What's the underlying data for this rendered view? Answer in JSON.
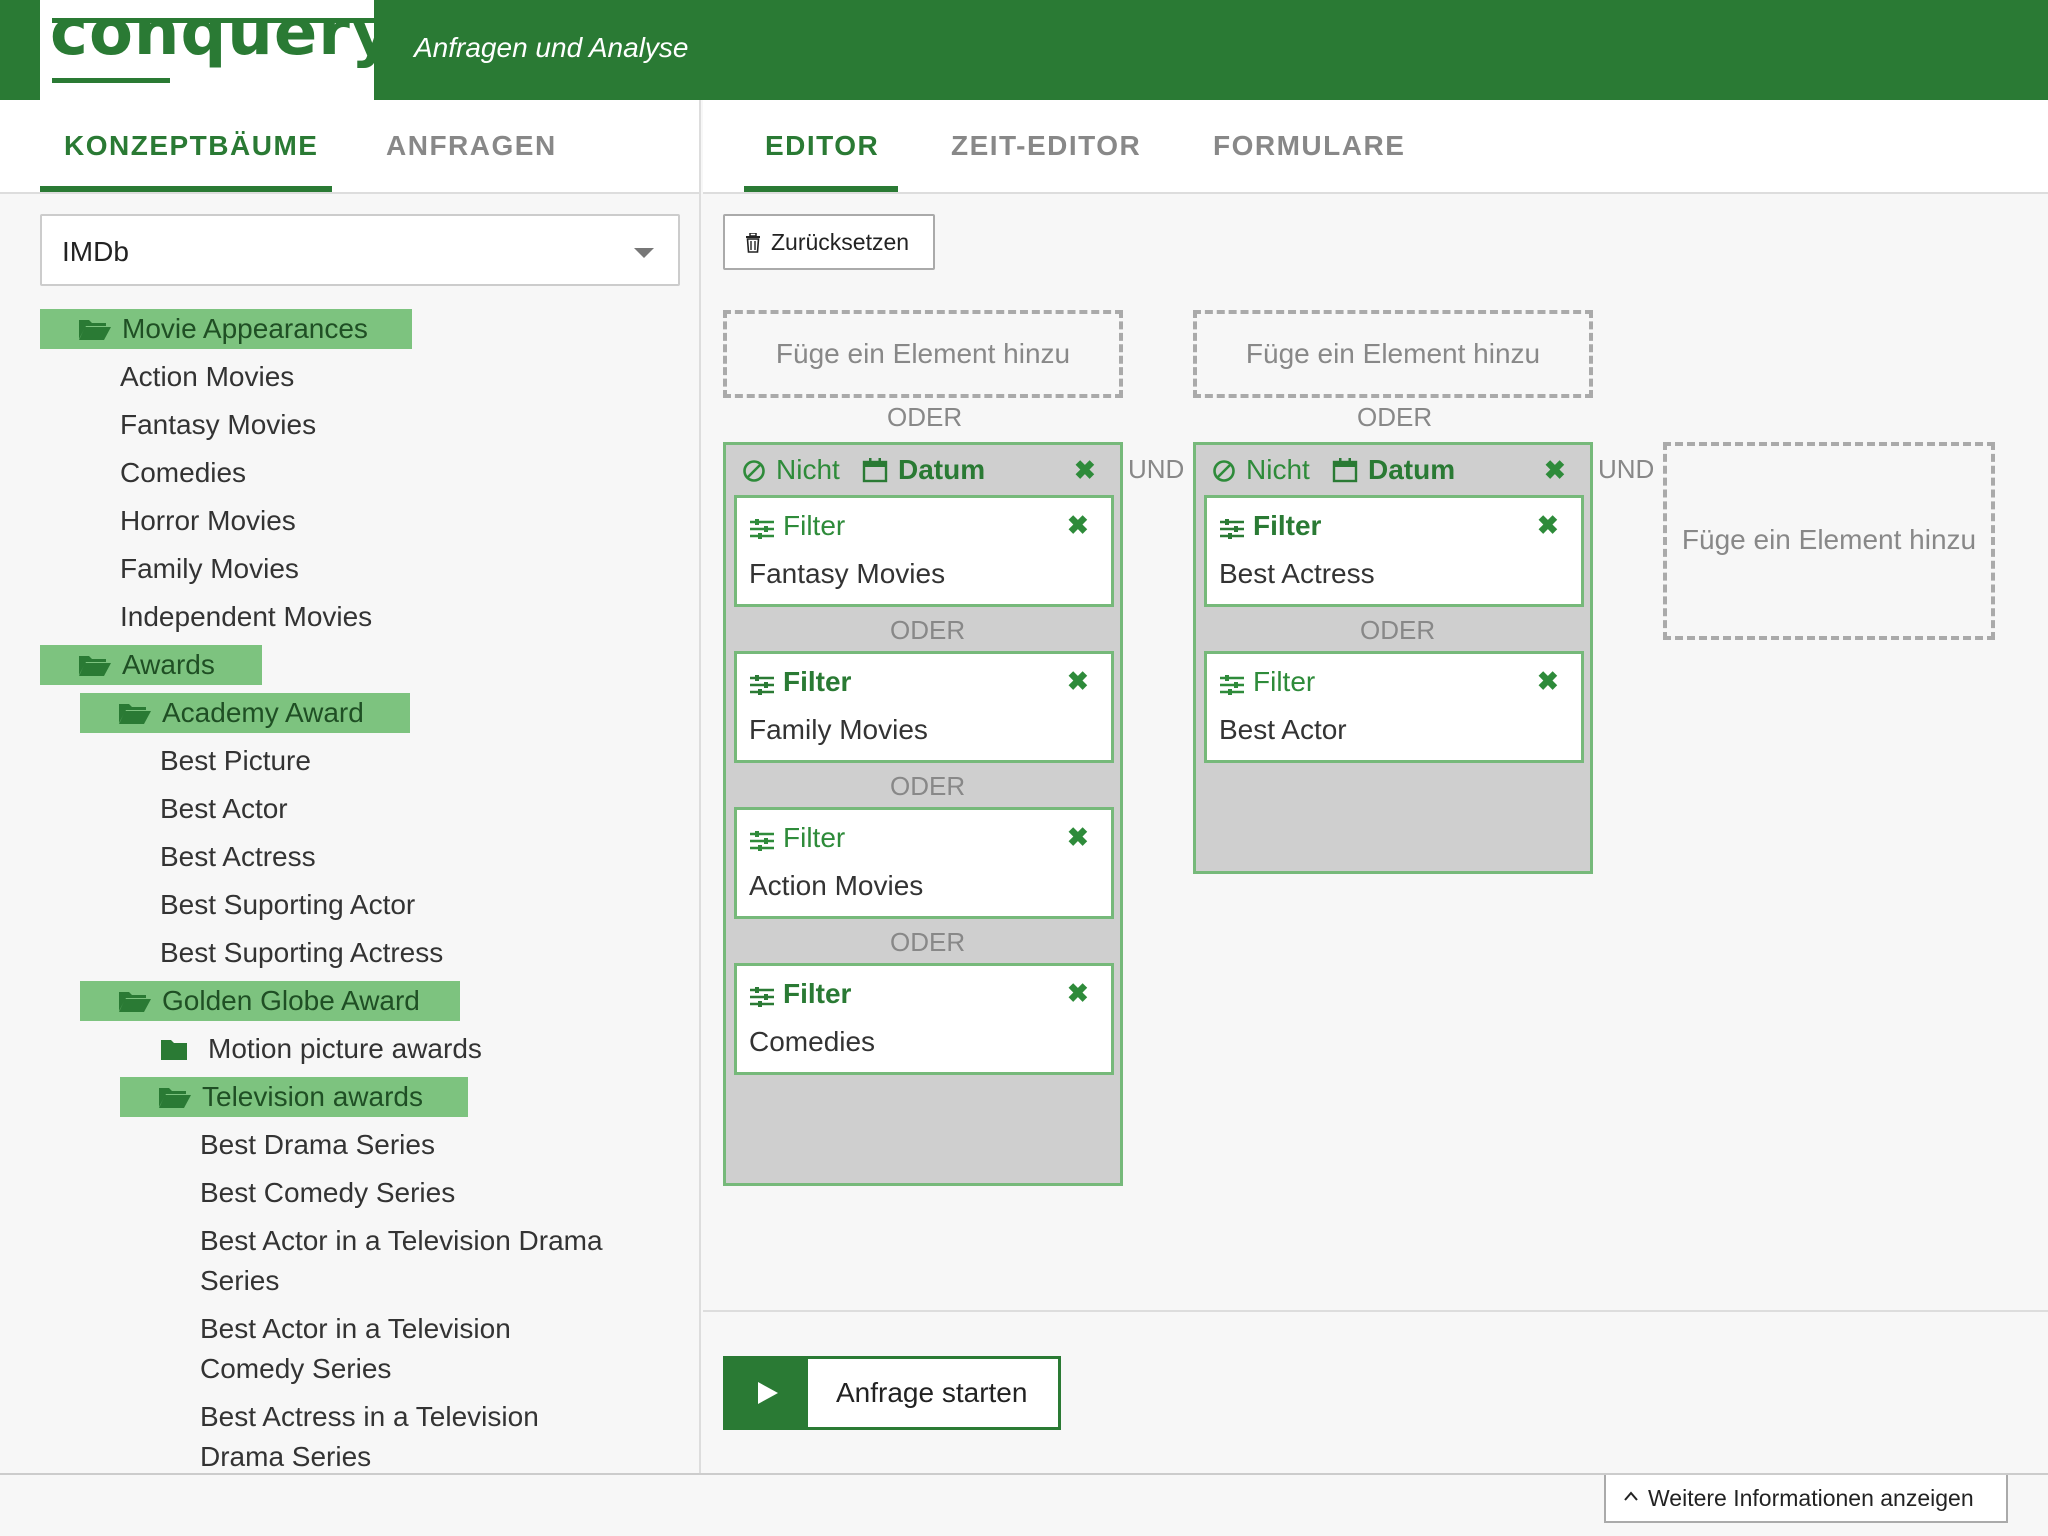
{
  "header": {
    "logo": "conquery",
    "subtitle": "Anfragen und Analyse"
  },
  "left_tabs": [
    {
      "label": "KONZEPTBÄUME",
      "active": true
    },
    {
      "label": "ANFRAGEN",
      "active": false
    }
  ],
  "right_tabs": [
    {
      "label": "EDITOR",
      "active": true
    },
    {
      "label": "ZEIT-EDITOR",
      "active": false
    },
    {
      "label": "FORMULARE",
      "active": false
    }
  ],
  "dataset_select": {
    "value": "IMDb"
  },
  "tree": [
    {
      "label": "Movie Appearances",
      "type": "folder-open"
    },
    {
      "label": "Action Movies",
      "type": "concept"
    },
    {
      "label": "Fantasy Movies",
      "type": "concept"
    },
    {
      "label": "Comedies",
      "type": "concept"
    },
    {
      "label": "Horror Movies",
      "type": "concept"
    },
    {
      "label": "Family Movies",
      "type": "concept"
    },
    {
      "label": "Independent Movies",
      "type": "concept"
    },
    {
      "label": "Awards",
      "type": "folder-open"
    },
    {
      "label": "Academy Award",
      "type": "folder-open"
    },
    {
      "label": "Best Picture",
      "type": "concept"
    },
    {
      "label": "Best Actor",
      "type": "concept"
    },
    {
      "label": "Best Actress",
      "type": "concept"
    },
    {
      "label": "Best Suporting Actor",
      "type": "concept"
    },
    {
      "label": "Best Suporting Actress",
      "type": "concept"
    },
    {
      "label": "Golden Globe Award",
      "type": "folder-open"
    },
    {
      "label": "Motion picture awards",
      "type": "folder-closed"
    },
    {
      "label": "Television awards",
      "type": "folder-open"
    },
    {
      "label": "Best Drama Series",
      "type": "concept"
    },
    {
      "label": "Best Comedy Series",
      "type": "concept"
    },
    {
      "label": "Best Actor in a Television Drama Series",
      "type": "concept"
    },
    {
      "label": "Best Actor in a Television Comedy Series",
      "type": "concept"
    },
    {
      "label": "Best Actress in a Television Drama Series",
      "type": "concept"
    }
  ],
  "editor": {
    "reset_label": "Zurücksetzen",
    "dropzone_label": "Füge ein Element hinzu",
    "or_label": "ODER",
    "and_label": "UND",
    "not_label": "Nicht",
    "date_label": "Datum",
    "filter_label": "Filter",
    "groups": [
      {
        "nodes": [
          {
            "label": "Fantasy Movies",
            "filter_active": false
          },
          {
            "label": "Family Movies",
            "filter_active": true
          },
          {
            "label": "Action Movies",
            "filter_active": false
          },
          {
            "label": "Comedies",
            "filter_active": true
          }
        ]
      },
      {
        "nodes": [
          {
            "label": "Best Actress",
            "filter_active": true
          },
          {
            "label": "Best Actor",
            "filter_active": false
          }
        ]
      }
    ],
    "run_label": "Anfrage starten"
  },
  "footer": {
    "more_info_label": "Weitere Informationen anzeigen"
  },
  "colors": {
    "brand": "#2a7a34",
    "folder_highlight": "#7dc37f",
    "node_border": "#76b97a"
  }
}
